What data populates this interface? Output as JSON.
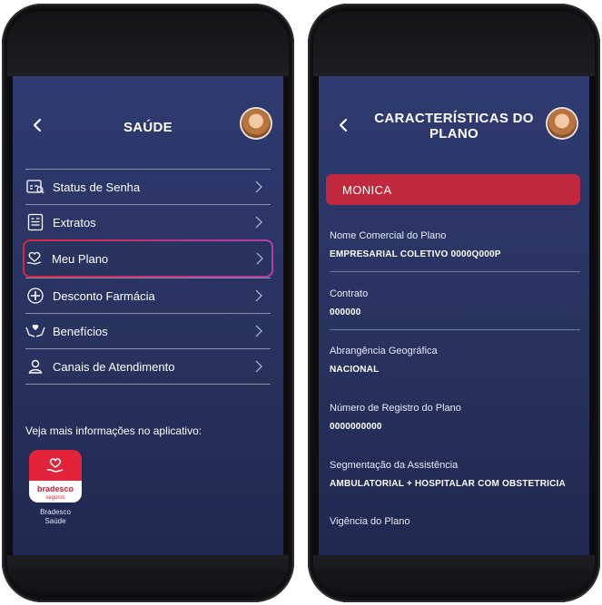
{
  "left_screen": {
    "title": "SAÚDE",
    "menu": [
      {
        "label": "Status de Senha",
        "icon": "password-status-icon"
      },
      {
        "label": "Extratos",
        "icon": "statement-icon"
      },
      {
        "label": "Meu Plano",
        "icon": "heart-hand-icon",
        "highlighted": true
      },
      {
        "label": "Desconto Farmácia",
        "icon": "pharmacy-icon"
      },
      {
        "label": "Benefícios",
        "icon": "benefits-icon"
      },
      {
        "label": "Canais de Atendimento",
        "icon": "person-icon"
      }
    ],
    "footer_text": "Veja mais informações no aplicativo:",
    "app": {
      "brand": "bradesco",
      "brand_sub": "seguros",
      "label_line1": "Bradesco",
      "label_line2": "Saúde"
    }
  },
  "right_screen": {
    "title_line1": "CARACTERÍSTICAS DO",
    "title_line2": "PLANO",
    "name": "MONICA",
    "fields": [
      {
        "label": "Nome Comercial do Plano",
        "value": "EMPRESARIAL COLETIVO 0000Q000P"
      },
      {
        "label": "Contrato",
        "value": "000000"
      },
      {
        "label": "Abrangência Geográfica",
        "value": "NACIONAL"
      },
      {
        "label": "Número de Registro do Plano",
        "value": "0000000000"
      },
      {
        "label": "Segmentação da Assistência",
        "value": "AMBULATORIAL + HOSPITALAR COM OBSTETRICIA"
      },
      {
        "label": "Vigência do Plano",
        "value": ""
      }
    ]
  },
  "colors": {
    "screen_bg": "#2a3566",
    "name_bar": "#c2283d",
    "brand_red": "#e2233a",
    "highlight_gradient_start": "#d7263d",
    "highlight_gradient_end": "#b43ab0"
  }
}
